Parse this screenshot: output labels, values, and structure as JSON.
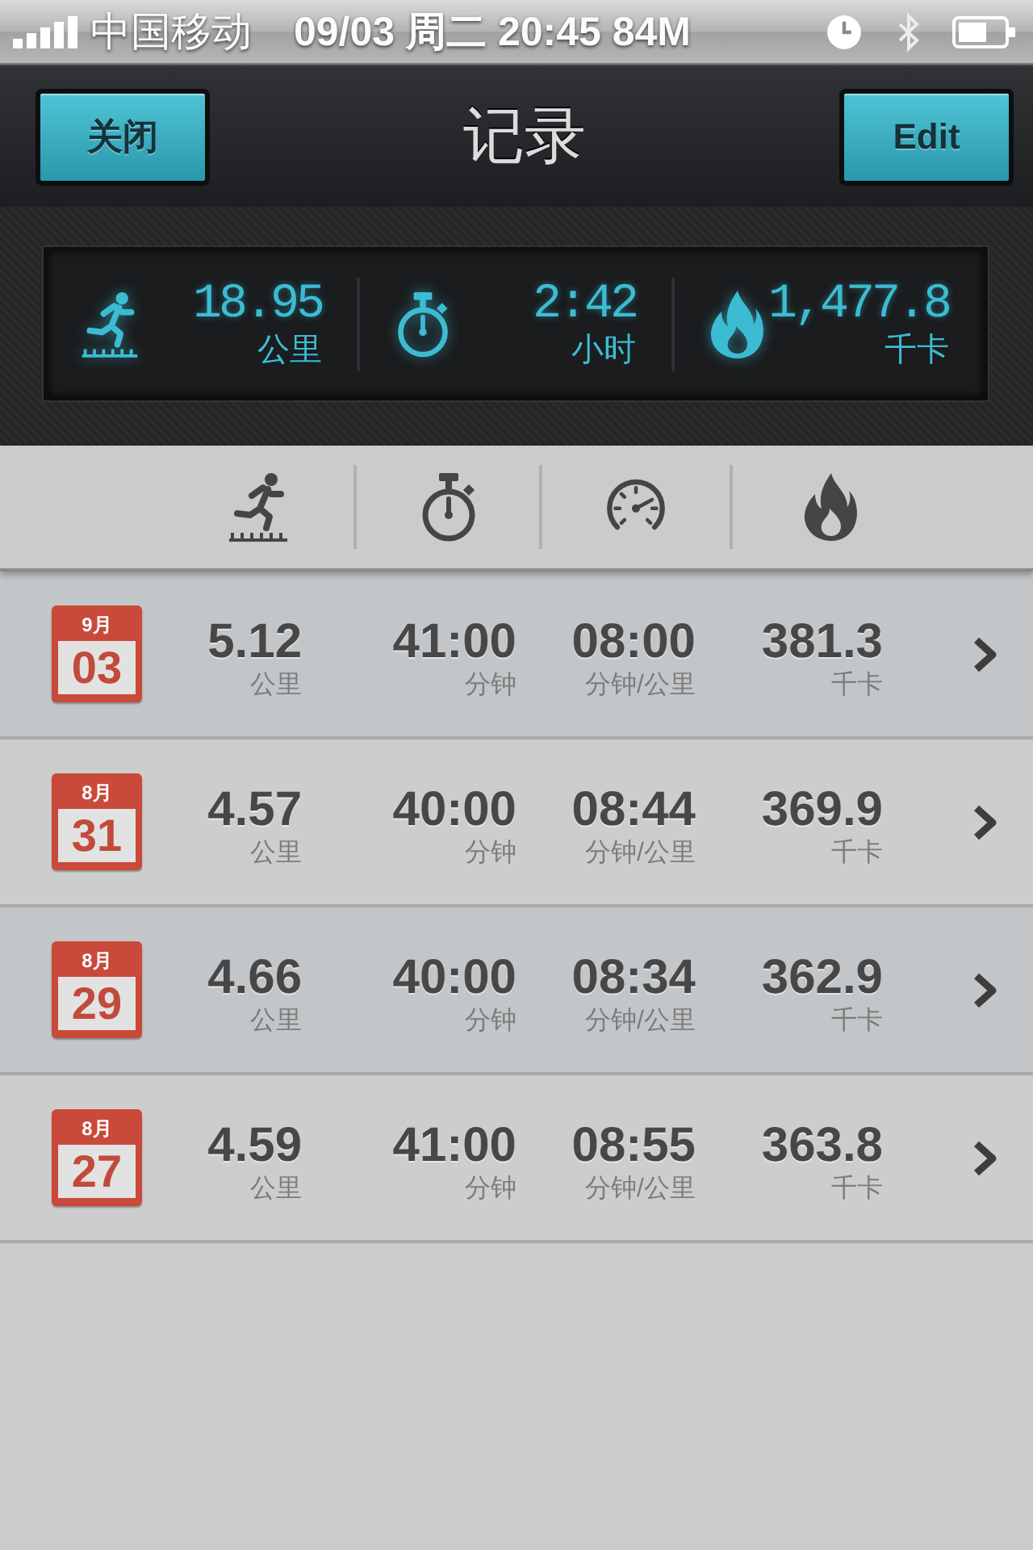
{
  "status_bar": {
    "carrier": "中国移动",
    "datetime": "09/03 周二 20:45 84M"
  },
  "nav_bar": {
    "left_button": "关闭",
    "title": "记录",
    "right_button": "Edit"
  },
  "summary": [
    {
      "kind": "distance",
      "value": "18.95",
      "unit": "公里"
    },
    {
      "kind": "duration",
      "value": "2:42",
      "unit": "小时"
    },
    {
      "kind": "calories",
      "value": "1,477.8",
      "unit": "千卡"
    }
  ],
  "columns": [
    {
      "kind": "distance"
    },
    {
      "kind": "duration"
    },
    {
      "kind": "pace"
    },
    {
      "kind": "calories"
    }
  ],
  "records": [
    {
      "month": "9月",
      "day": "03",
      "metrics": [
        {
          "value": "5.12",
          "unit": "公里"
        },
        {
          "value": "41:00",
          "unit": "分钟"
        },
        {
          "value": "08:00",
          "unit": "分钟/公里"
        },
        {
          "value": "381.3",
          "unit": "千卡"
        }
      ]
    },
    {
      "month": "8月",
      "day": "31",
      "metrics": [
        {
          "value": "4.57",
          "unit": "公里"
        },
        {
          "value": "40:00",
          "unit": "分钟"
        },
        {
          "value": "08:44",
          "unit": "分钟/公里"
        },
        {
          "value": "369.9",
          "unit": "千卡"
        }
      ]
    },
    {
      "month": "8月",
      "day": "29",
      "metrics": [
        {
          "value": "4.66",
          "unit": "公里"
        },
        {
          "value": "40:00",
          "unit": "分钟"
        },
        {
          "value": "08:34",
          "unit": "分钟/公里"
        },
        {
          "value": "362.9",
          "unit": "千卡"
        }
      ]
    },
    {
      "month": "8月",
      "day": "27",
      "metrics": [
        {
          "value": "4.59",
          "unit": "公里"
        },
        {
          "value": "41:00",
          "unit": "分钟"
        },
        {
          "value": "08:55",
          "unit": "分钟/公里"
        },
        {
          "value": "363.8",
          "unit": "千卡"
        }
      ]
    }
  ]
}
